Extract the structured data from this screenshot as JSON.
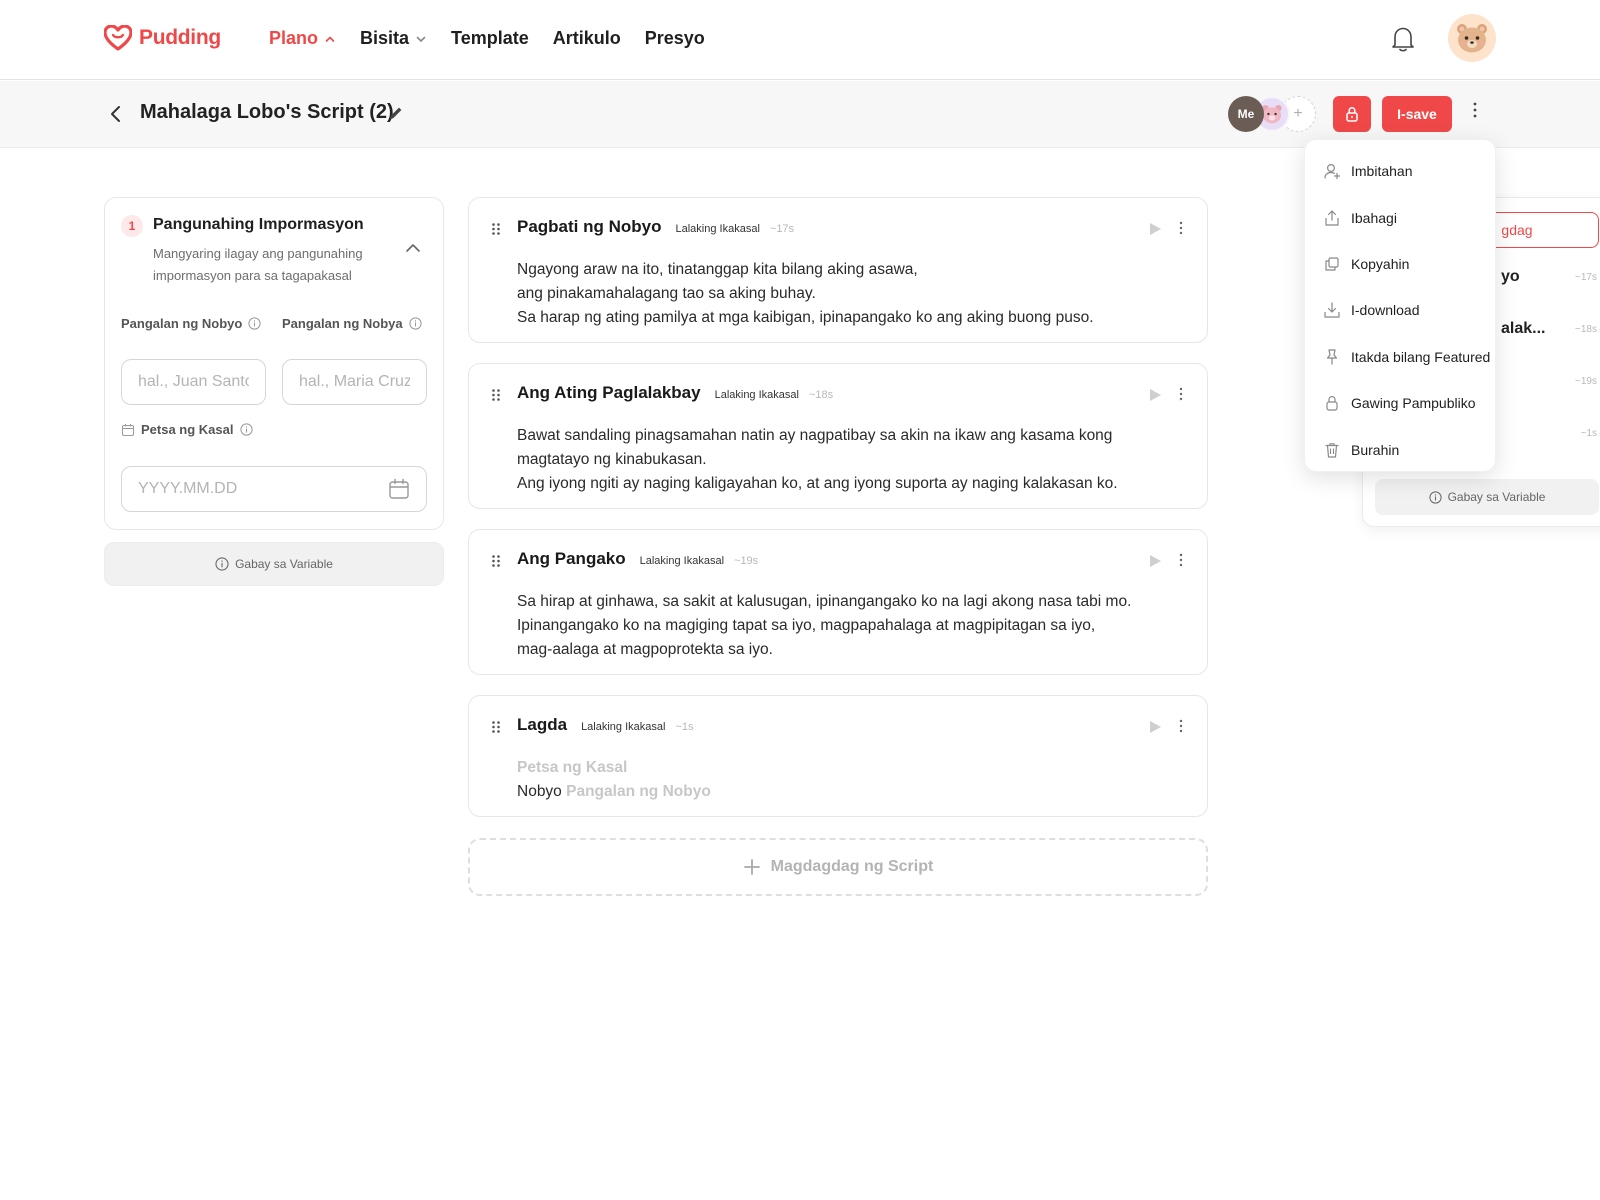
{
  "brand": {
    "name": "Pudding",
    "accent": "#f04848"
  },
  "nav": {
    "items": [
      {
        "label": "Plano",
        "active": true,
        "dropdown": true
      },
      {
        "label": "Bisita",
        "active": false,
        "dropdown": true
      },
      {
        "label": "Template",
        "active": false,
        "dropdown": false
      },
      {
        "label": "Artikulo",
        "active": false,
        "dropdown": false
      },
      {
        "label": "Presyo",
        "active": false,
        "dropdown": false
      }
    ]
  },
  "toolbar": {
    "title": "Mahalaga Lobo's Script (2)",
    "collaborator_me": "Me",
    "add_symbol": "+",
    "save_label": "I-save"
  },
  "info_card": {
    "step": "1",
    "title": "Pangunahing Impormasyon",
    "description": "Mangyaring ilagay ang pangunahing impormasyon para sa tagapakasal",
    "groom_label": "Pangalan ng Nobyo",
    "bride_label": "Pangalan ng Nobya",
    "groom_placeholder": "hal., Juan Santos",
    "bride_placeholder": "hal., Maria Cruz",
    "date_label": "Petsa ng Kasal",
    "date_placeholder": "YYYY.MM.DD"
  },
  "variable_guide_label": "Gabay sa Variable",
  "scripts": [
    {
      "title": "Pagbati ng Nobyo",
      "voice": "Lalaking Ikakasal",
      "duration": "~17s",
      "lines": [
        "Ngayong araw na ito, tinatanggap kita bilang aking asawa,",
        "ang pinakamahalagang tao sa aking buhay.",
        "Sa harap ng ating pamilya at mga kaibigan, ipinapangako ko ang aking buong puso."
      ]
    },
    {
      "title": "Ang Ating Paglalakbay",
      "voice": "Lalaking Ikakasal",
      "duration": "~18s",
      "lines": [
        "Bawat sandaling pinagsamahan natin ay nagpatibay sa akin na ikaw ang kasama kong magtatayo ng kinabukasan.",
        "Ang iyong ngiti ay naging kaligayahan ko, at ang iyong suporta ay naging kalakasan ko."
      ]
    },
    {
      "title": "Ang Pangako",
      "voice": "Lalaking Ikakasal",
      "duration": "~19s",
      "lines": [
        "Sa hirap at ginhawa, sa sakit at kalusugan, ipinangangako ko na lagi akong nasa tabi mo.",
        "Ipinangangako ko na magiging tapat sa iyo, magpapahalaga at magpipitagan sa iyo,",
        "mag-aalaga at magpoprotekta sa iyo."
      ]
    },
    {
      "title": "Lagda",
      "voice": "Lalaking Ikakasal",
      "duration": "~1s",
      "var_date": "Petsa ng Kasal",
      "prefix": "Nobyo",
      "var_groom": "Pangalan ng Nobyo"
    }
  ],
  "add_script_label": "Magdagdag ng Script",
  "right_panel": {
    "add_label": "gdag",
    "rows": [
      {
        "text": "yo",
        "duration": "~17s"
      },
      {
        "text": "alak...",
        "duration": "~18s"
      },
      {
        "text": "",
        "duration": "~19s"
      },
      {
        "text": "",
        "duration": "~1s"
      }
    ],
    "guide_label": "Gabay sa Variable"
  },
  "menu": {
    "items": [
      {
        "label": "Imbitahan",
        "icon": "user-plus-icon"
      },
      {
        "label": "Ibahagi",
        "icon": "share-icon"
      },
      {
        "label": "Kopyahin",
        "icon": "copy-icon"
      },
      {
        "label": "I-download",
        "icon": "download-icon"
      },
      {
        "label": "Itakda bilang Featured",
        "icon": "pin-icon"
      },
      {
        "label": "Gawing Pampubliko",
        "icon": "lock-icon"
      },
      {
        "label": "Burahin",
        "icon": "trash-icon"
      }
    ]
  }
}
